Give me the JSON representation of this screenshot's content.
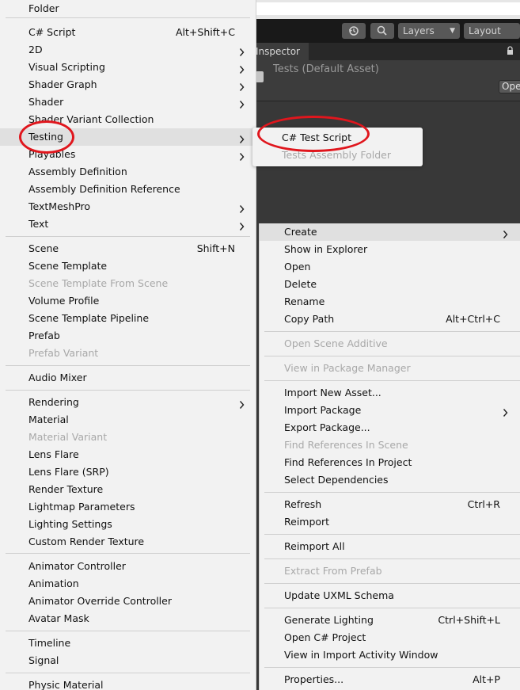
{
  "editor": {
    "layers_label": "Layers",
    "layout_label": "Layout",
    "inspector_tab": "Inspector",
    "inspector_title": "Tests (Default Asset)",
    "open_button": "Ope",
    "icons": [
      "history-icon",
      "search-icon",
      "lock-icon"
    ]
  },
  "main_menu": {
    "items": [
      {
        "label": "Folder",
        "shortcut": "",
        "submenu": false,
        "disabled": false
      },
      {
        "label": "C# Script",
        "shortcut": "Alt+Shift+C",
        "submenu": false,
        "disabled": false
      },
      {
        "label": "2D",
        "shortcut": "",
        "submenu": true,
        "disabled": false
      },
      {
        "label": "Visual Scripting",
        "shortcut": "",
        "submenu": true,
        "disabled": false
      },
      {
        "label": "Shader Graph",
        "shortcut": "",
        "submenu": true,
        "disabled": false
      },
      {
        "label": "Shader",
        "shortcut": "",
        "submenu": true,
        "disabled": false
      },
      {
        "label": "Shader Variant Collection",
        "shortcut": "",
        "submenu": false,
        "disabled": false
      },
      {
        "label": "Testing",
        "shortcut": "",
        "submenu": true,
        "disabled": false,
        "highlighted": true
      },
      {
        "label": "Playables",
        "shortcut": "",
        "submenu": true,
        "disabled": false
      },
      {
        "label": "Assembly Definition",
        "shortcut": "",
        "submenu": false,
        "disabled": false
      },
      {
        "label": "Assembly Definition Reference",
        "shortcut": "",
        "submenu": false,
        "disabled": false
      },
      {
        "label": "TextMeshPro",
        "shortcut": "",
        "submenu": true,
        "disabled": false
      },
      {
        "label": "Text",
        "shortcut": "",
        "submenu": true,
        "disabled": false
      },
      {
        "label": "Scene",
        "shortcut": "Shift+N",
        "submenu": false,
        "disabled": false
      },
      {
        "label": "Scene Template",
        "shortcut": "",
        "submenu": false,
        "disabled": false
      },
      {
        "label": "Scene Template From Scene",
        "shortcut": "",
        "submenu": false,
        "disabled": true
      },
      {
        "label": "Volume Profile",
        "shortcut": "",
        "submenu": false,
        "disabled": false
      },
      {
        "label": "Scene Template Pipeline",
        "shortcut": "",
        "submenu": false,
        "disabled": false
      },
      {
        "label": "Prefab",
        "shortcut": "",
        "submenu": false,
        "disabled": false
      },
      {
        "label": "Prefab Variant",
        "shortcut": "",
        "submenu": false,
        "disabled": true
      },
      {
        "label": "Audio Mixer",
        "shortcut": "",
        "submenu": false,
        "disabled": false
      },
      {
        "label": "Rendering",
        "shortcut": "",
        "submenu": true,
        "disabled": false
      },
      {
        "label": "Material",
        "shortcut": "",
        "submenu": false,
        "disabled": false
      },
      {
        "label": "Material Variant",
        "shortcut": "",
        "submenu": false,
        "disabled": true
      },
      {
        "label": "Lens Flare",
        "shortcut": "",
        "submenu": false,
        "disabled": false
      },
      {
        "label": "Lens Flare (SRP)",
        "shortcut": "",
        "submenu": false,
        "disabled": false
      },
      {
        "label": "Render Texture",
        "shortcut": "",
        "submenu": false,
        "disabled": false
      },
      {
        "label": "Lightmap Parameters",
        "shortcut": "",
        "submenu": false,
        "disabled": false
      },
      {
        "label": "Lighting Settings",
        "shortcut": "",
        "submenu": false,
        "disabled": false
      },
      {
        "label": "Custom Render Texture",
        "shortcut": "",
        "submenu": false,
        "disabled": false
      },
      {
        "label": "Animator Controller",
        "shortcut": "",
        "submenu": false,
        "disabled": false
      },
      {
        "label": "Animation",
        "shortcut": "",
        "submenu": false,
        "disabled": false
      },
      {
        "label": "Animator Override Controller",
        "shortcut": "",
        "submenu": false,
        "disabled": false
      },
      {
        "label": "Avatar Mask",
        "shortcut": "",
        "submenu": false,
        "disabled": false
      },
      {
        "label": "Timeline",
        "shortcut": "",
        "submenu": false,
        "disabled": false
      },
      {
        "label": "Signal",
        "shortcut": "",
        "submenu": false,
        "disabled": false
      },
      {
        "label": "Physic Material",
        "shortcut": "",
        "submenu": false,
        "disabled": false
      }
    ]
  },
  "testing_submenu": {
    "items": [
      {
        "label": "C# Test Script",
        "disabled": false
      },
      {
        "label": "Tests Assembly Folder",
        "disabled": true
      }
    ]
  },
  "context_menu": {
    "items": [
      {
        "label": "Create",
        "shortcut": "",
        "submenu": true,
        "disabled": false,
        "highlighted": true
      },
      {
        "label": "Show in Explorer",
        "shortcut": "",
        "submenu": false,
        "disabled": false
      },
      {
        "label": "Open",
        "shortcut": "",
        "submenu": false,
        "disabled": false
      },
      {
        "label": "Delete",
        "shortcut": "",
        "submenu": false,
        "disabled": false
      },
      {
        "label": "Rename",
        "shortcut": "",
        "submenu": false,
        "disabled": false
      },
      {
        "label": "Copy Path",
        "shortcut": "Alt+Ctrl+C",
        "submenu": false,
        "disabled": false
      },
      {
        "label": "Open Scene Additive",
        "shortcut": "",
        "submenu": false,
        "disabled": true
      },
      {
        "label": "View in Package Manager",
        "shortcut": "",
        "submenu": false,
        "disabled": true
      },
      {
        "label": "Import New Asset...",
        "shortcut": "",
        "submenu": false,
        "disabled": false
      },
      {
        "label": "Import Package",
        "shortcut": "",
        "submenu": true,
        "disabled": false
      },
      {
        "label": "Export Package...",
        "shortcut": "",
        "submenu": false,
        "disabled": false
      },
      {
        "label": "Find References In Scene",
        "shortcut": "",
        "submenu": false,
        "disabled": true
      },
      {
        "label": "Find References In Project",
        "shortcut": "",
        "submenu": false,
        "disabled": false
      },
      {
        "label": "Select Dependencies",
        "shortcut": "",
        "submenu": false,
        "disabled": false
      },
      {
        "label": "Refresh",
        "shortcut": "Ctrl+R",
        "submenu": false,
        "disabled": false
      },
      {
        "label": "Reimport",
        "shortcut": "",
        "submenu": false,
        "disabled": false
      },
      {
        "label": "Reimport All",
        "shortcut": "",
        "submenu": false,
        "disabled": false
      },
      {
        "label": "Extract From Prefab",
        "shortcut": "",
        "submenu": false,
        "disabled": true
      },
      {
        "label": "Update UXML Schema",
        "shortcut": "",
        "submenu": false,
        "disabled": false
      },
      {
        "label": "Generate Lighting",
        "shortcut": "Ctrl+Shift+L",
        "submenu": false,
        "disabled": false
      },
      {
        "label": "Open C# Project",
        "shortcut": "",
        "submenu": false,
        "disabled": false
      },
      {
        "label": "View in Import Activity Window",
        "shortcut": "",
        "submenu": false,
        "disabled": false
      },
      {
        "label": "Properties...",
        "shortcut": "Alt+P",
        "submenu": false,
        "disabled": false
      }
    ]
  },
  "colors": {
    "menu_bg": "#f2f2f2",
    "menu_highlight": "#e0e0e0",
    "disabled_text": "#a8a8a8",
    "annotation_circle": "#e0161d",
    "editor_dark": "#383838"
  }
}
